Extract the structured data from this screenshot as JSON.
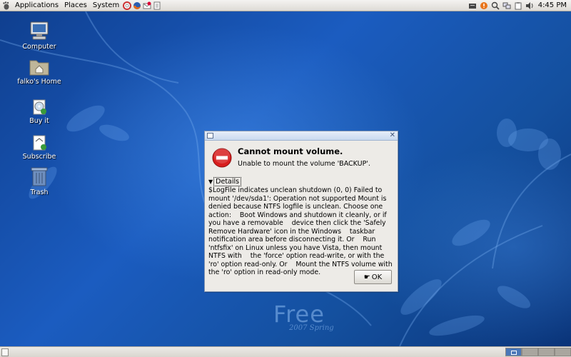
{
  "top_panel": {
    "menus": [
      "Applications",
      "Places",
      "System"
    ],
    "clock": "4:45 PM"
  },
  "desktop": {
    "icons": [
      {
        "label": "Computer"
      },
      {
        "label": "falko's Home"
      },
      {
        "label": "Buy it"
      },
      {
        "label": "Subscribe"
      },
      {
        "label": "Trash"
      }
    ],
    "wallpaper": {
      "brand": "Free",
      "sub": "2007 Spring"
    }
  },
  "dialog": {
    "title": "Cannot mount volume.",
    "message": "Unable to mount the volume 'BACKUP'.",
    "details_label": "Details",
    "details_text": "$LogFile indicates unclean shutdown (0, 0) Failed to mount '/dev/sda1': Operation not supported Mount is denied because NTFS logfile is unclean. Choose one action:    Boot Windows and shutdown it cleanly, or if you have a removable    device then click the 'Safely Remove Hardware' icon in the Windows    taskbar notification area before disconnecting it. Or    Run 'ntfsfix' on Linux unless you have Vista, then mount NTFS with    the 'force' option read-write, or with the 'ro' option read-only. Or    Mount the NTFS volume with the 'ro' option in read-only mode.",
    "ok_label": "OK"
  },
  "colors": {
    "error_red": "#d81e1e",
    "desktop_blue": "#1b5cc0"
  }
}
